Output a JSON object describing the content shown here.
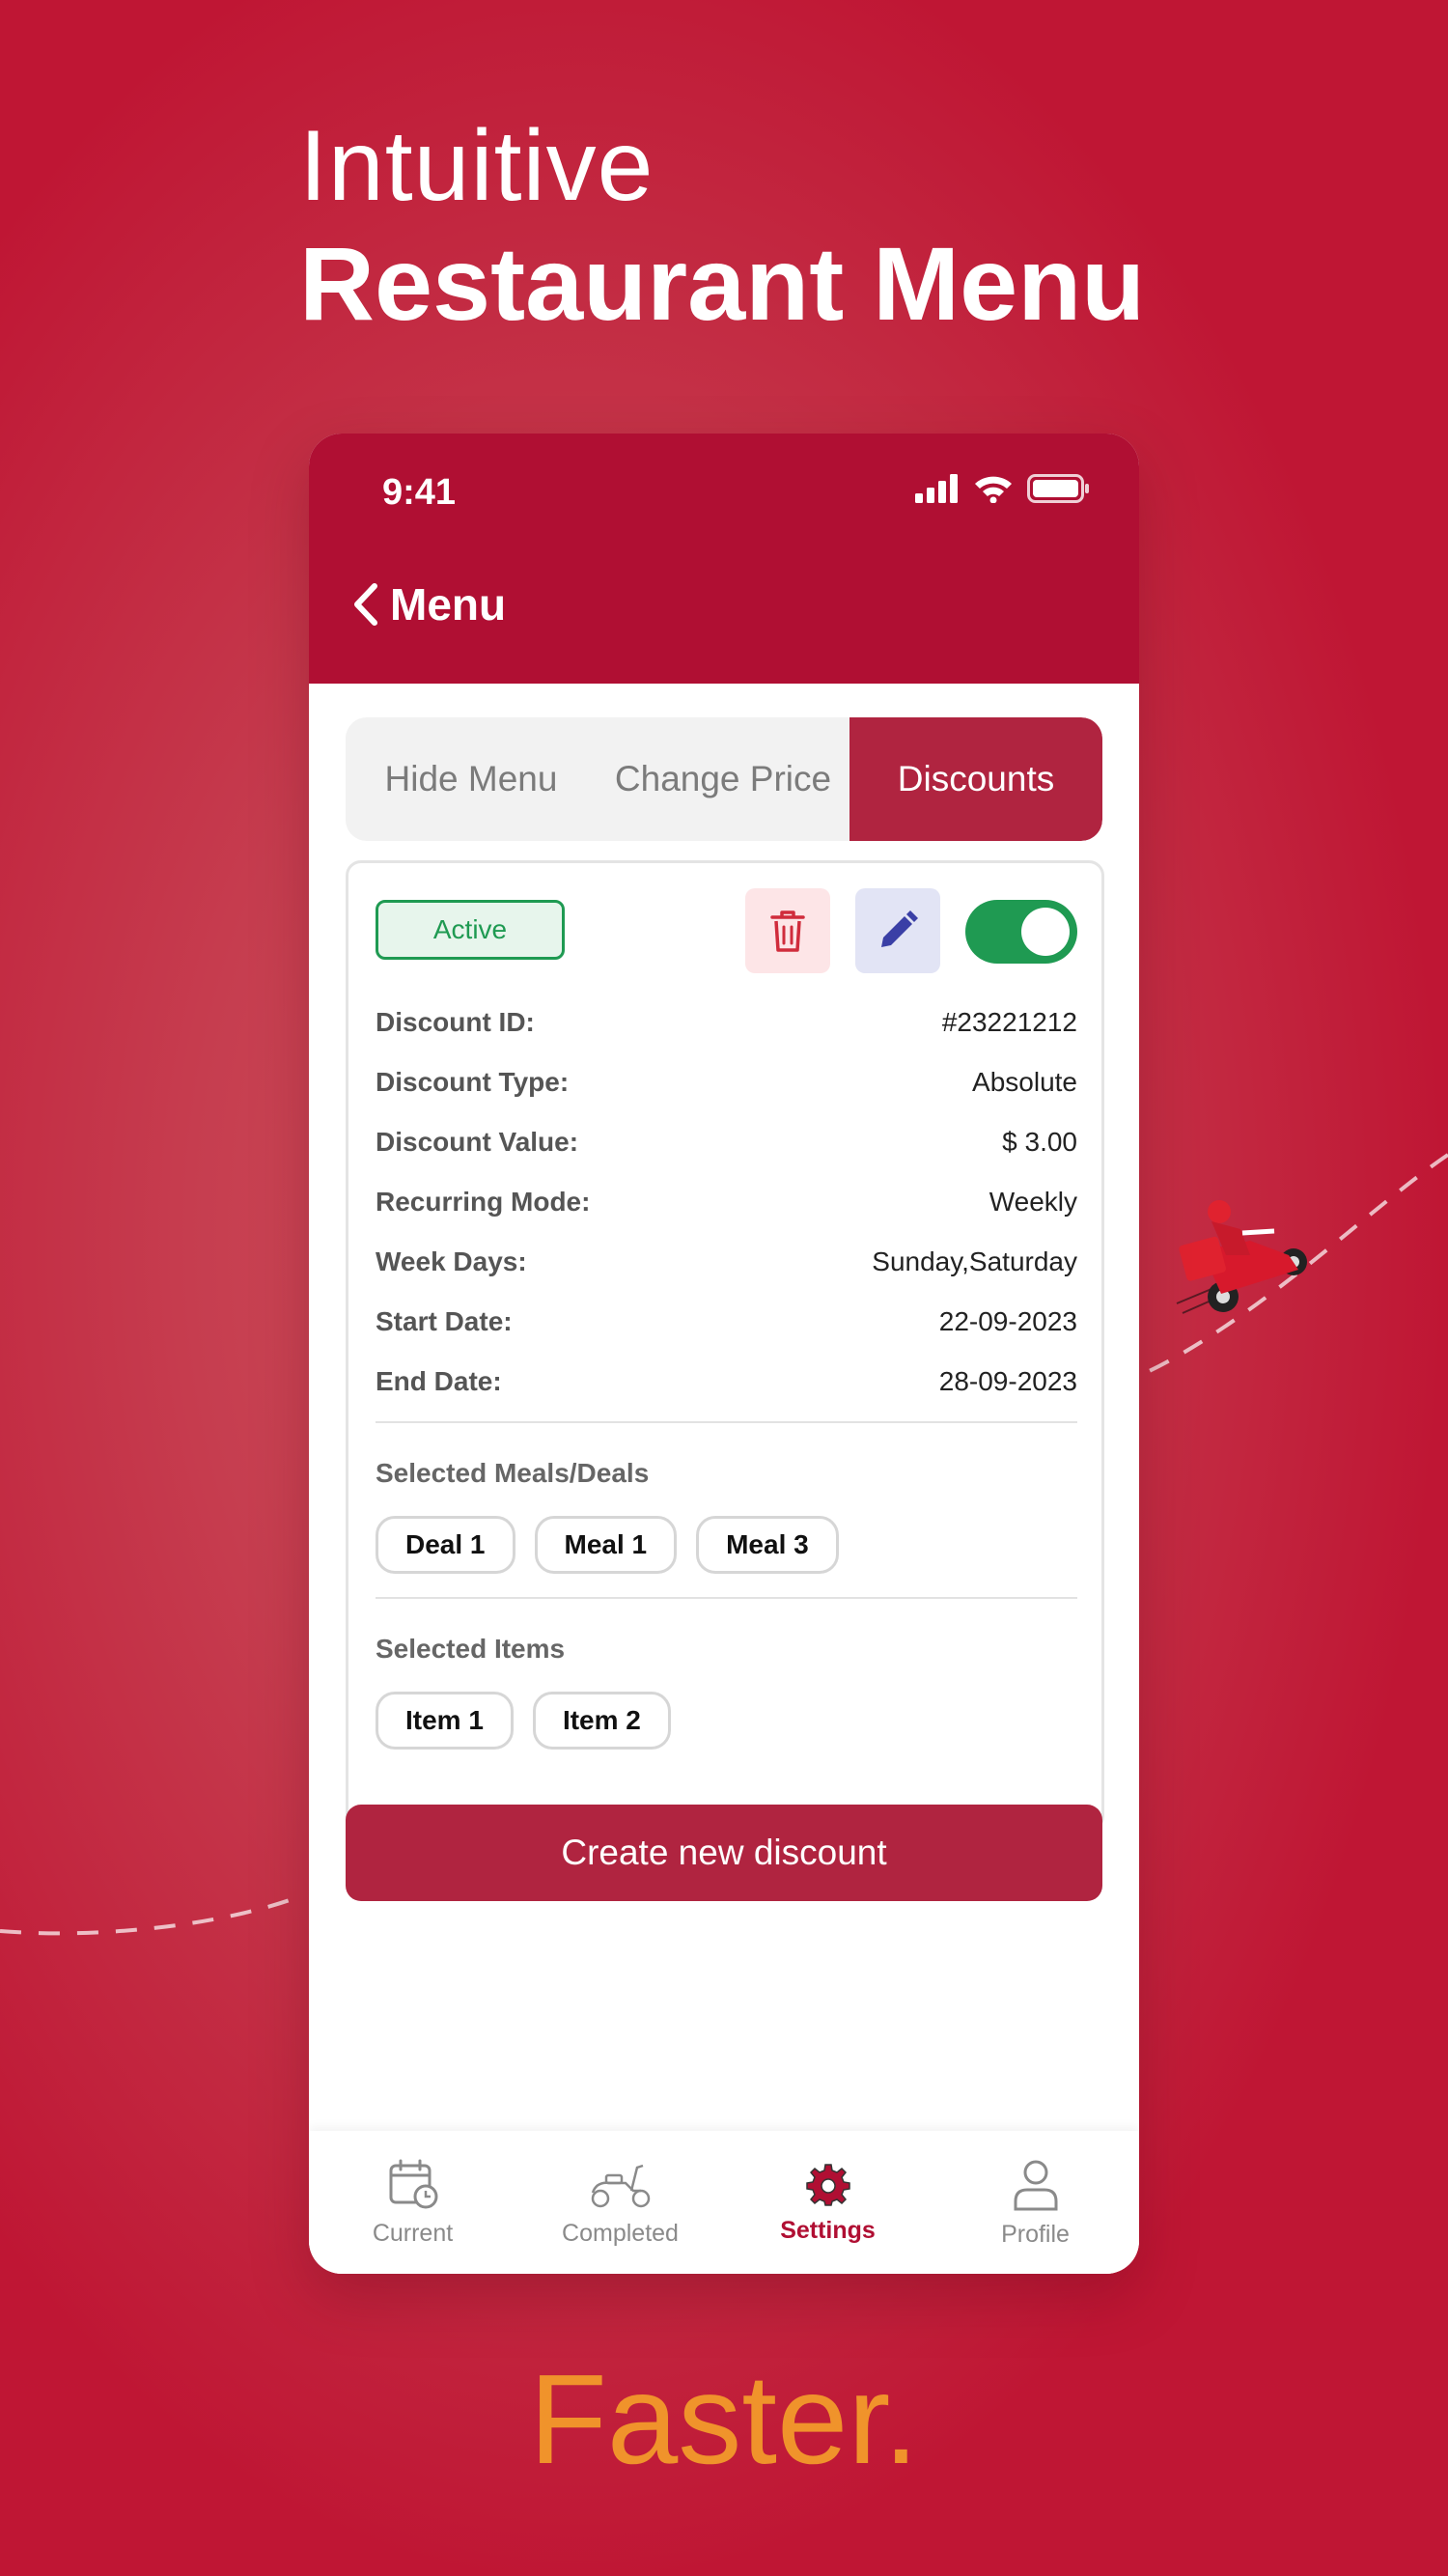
{
  "marketing": {
    "headline_light": "Intuitive",
    "headline_bold": "Restaurant Menu",
    "tagline": "Faster."
  },
  "colors": {
    "brand": "#b00f33",
    "accent": "#b02440",
    "success": "#1f9a52",
    "tagline": "#f0932b"
  },
  "status_bar": {
    "time": "9:41"
  },
  "header": {
    "back_icon": "chevron-left-icon",
    "title": "Menu"
  },
  "tabs": [
    {
      "label": "Hide Menu",
      "selected": false
    },
    {
      "label": "Change Price",
      "selected": false
    },
    {
      "label": "Discounts",
      "selected": true
    }
  ],
  "discount": {
    "status": "Active",
    "enabled": true,
    "fields": [
      {
        "label": "Discount ID:",
        "value": "#23221212"
      },
      {
        "label": "Discount Type:",
        "value": "Absolute"
      },
      {
        "label": "Discount Value:",
        "value": "$ 3.00"
      },
      {
        "label": "Recurring Mode:",
        "value": "Weekly"
      },
      {
        "label": "Week Days:",
        "value": "Sunday,Saturday"
      },
      {
        "label": "Start Date:",
        "value": "22-09-2023"
      },
      {
        "label": "End Date:",
        "value": "28-09-2023"
      }
    ],
    "meals_label": "Selected Meals/Deals",
    "meals": [
      "Deal 1",
      "Meal 1",
      "Meal 3"
    ],
    "items_label": "Selected Items",
    "items": [
      "Item 1",
      "Item 2"
    ]
  },
  "create_button": "Create new discount",
  "bottom_nav": [
    {
      "label": "Current",
      "icon": "calendar-clock-icon",
      "active": false
    },
    {
      "label": "Completed",
      "icon": "scooter-icon",
      "active": false
    },
    {
      "label": "Settings",
      "icon": "gear-icon",
      "active": true
    },
    {
      "label": "Profile",
      "icon": "user-icon",
      "active": false
    }
  ]
}
